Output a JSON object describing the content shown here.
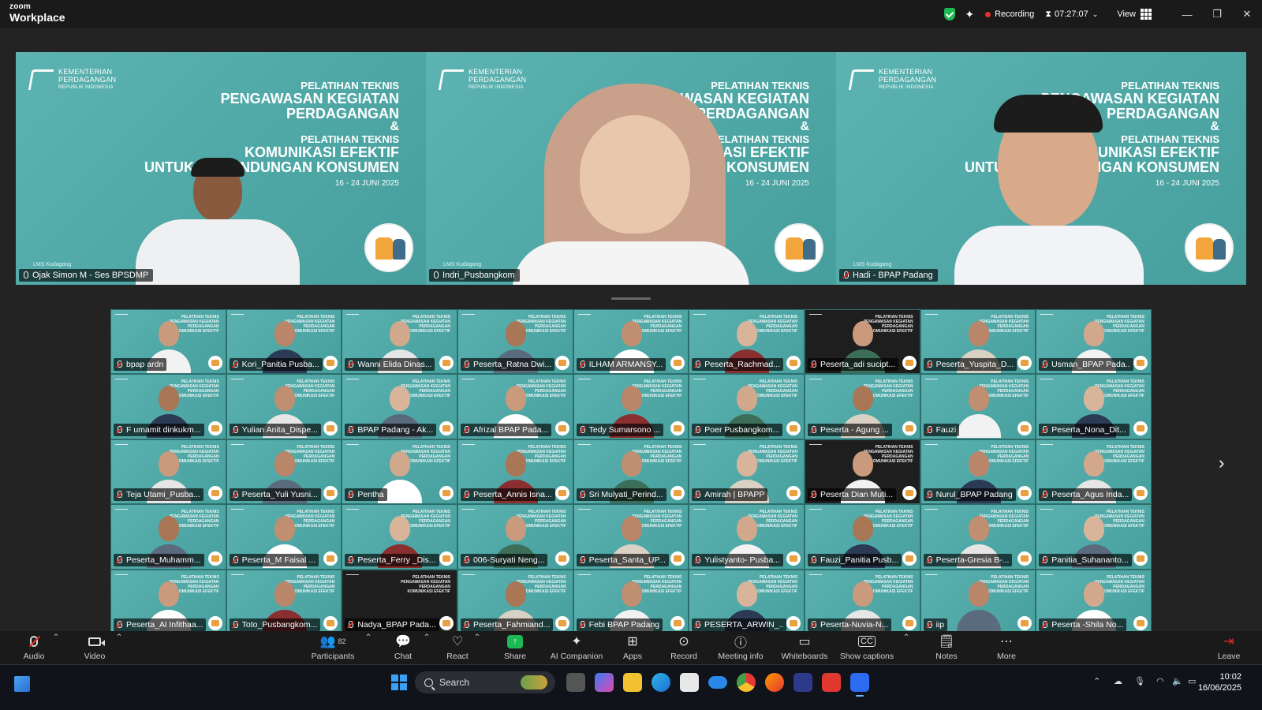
{
  "app": {
    "brand_line1": "zoom",
    "brand_line2": "Workplace",
    "recording_label": "Recording",
    "timer": "07:27:07",
    "view_label": "View"
  },
  "slide": {
    "org_line1": "KEMENTERIAN",
    "org_line2": "PERDAGANGAN",
    "org_line3": "REPUBLIK INDONESIA",
    "line1": "PELATIHAN TEKNIS",
    "line2": "PENGAWASAN KEGIATAN",
    "line3": "PERDAGANGAN",
    "amp": "&",
    "line4": "PELATIHAN TEKNIS",
    "line5": "KOMUNIKASI EFEKTIF",
    "line6": "UNTUK PERLINDUNGAN KONSUMEN",
    "date": "16 - 24 JUNI 2025",
    "lms": "LMS Kudagang"
  },
  "speakers": [
    {
      "name": "Ojak Simon M - Ses BPSDMP"
    },
    {
      "name": "Indri_Pusbangkom"
    },
    {
      "name": "Hadi - BPAP Padang"
    }
  ],
  "gallery": [
    "bpap ardn",
    "Kori_Panitia Pusba...",
    "Wanni Elida Dinas...",
    "Peserta_Ratna Dwi...",
    "ILHAM ARMANSY...",
    "Peserta_Rachmad...",
    "Peserta_adi sucipt...",
    "Peserta_Yuspita_D...",
    "Usman_BPAP Pada...",
    "F umamit dinkukm...",
    "Yulian Anita_Dispe...",
    "BPAP Padang - Ak...",
    "Afrizal BPAP Pada...",
    "Tedy Sumarsono ...",
    "Poer Pusbangkom...",
    "Peserta - Agung ...",
    "Fauzi",
    "Peserta_Nona_Dit...",
    "Teja Utami_Pusba...",
    "Peserta_Yuli Yusni...",
    "Pentha",
    "Peserta_Annis Isna...",
    "Sri Mulyati_Perind...",
    "Amirah | BPAPP",
    "Peserta Dian Muti...",
    "Nurul_BPAP Padang",
    "Peserta_Agus Inda...",
    "Peserta_Muhamm...",
    "Peserta_M Faisal ...",
    "Peserta_Ferry _Dis...",
    "006-Suryati Neng...",
    "Peserta_Santa_UP...",
    "Yulistyanto- Pusba...",
    "Fauzi_Panitia Pusb...",
    "Peserta-Gresia B-...",
    "Panitia_Suhananto...",
    "Peserta_Al Infithaa...",
    "Toto_Pusbangkom...",
    "Nadya_BPAP Pada...",
    "Peserta_Fahmiand...",
    "Febi BPAP Padang",
    "PESERTA_ARWIN_...",
    "Peserta-Nuvia-N...",
    "iip",
    "Peserta -Shila No..."
  ],
  "toolbar": {
    "audio": "Audio",
    "video": "Video",
    "participants": "Participants",
    "participants_count": "82",
    "chat": "Chat",
    "react": "React",
    "share": "Share",
    "ai_companion": "AI Companion",
    "apps": "Apps",
    "record": "Record",
    "meeting_info": "Meeting info",
    "whiteboards": "Whiteboards",
    "show_captions": "Show captions",
    "notes": "Notes",
    "more": "More",
    "leave": "Leave"
  },
  "taskbar": {
    "search_placeholder": "Search",
    "time": "10:02",
    "date": "16/06/2025"
  },
  "colors": {
    "slide_teal": "#4ea8a8",
    "active_speaker": "#23d160",
    "recording_red": "#e5302e",
    "share_green": "#1db954"
  }
}
